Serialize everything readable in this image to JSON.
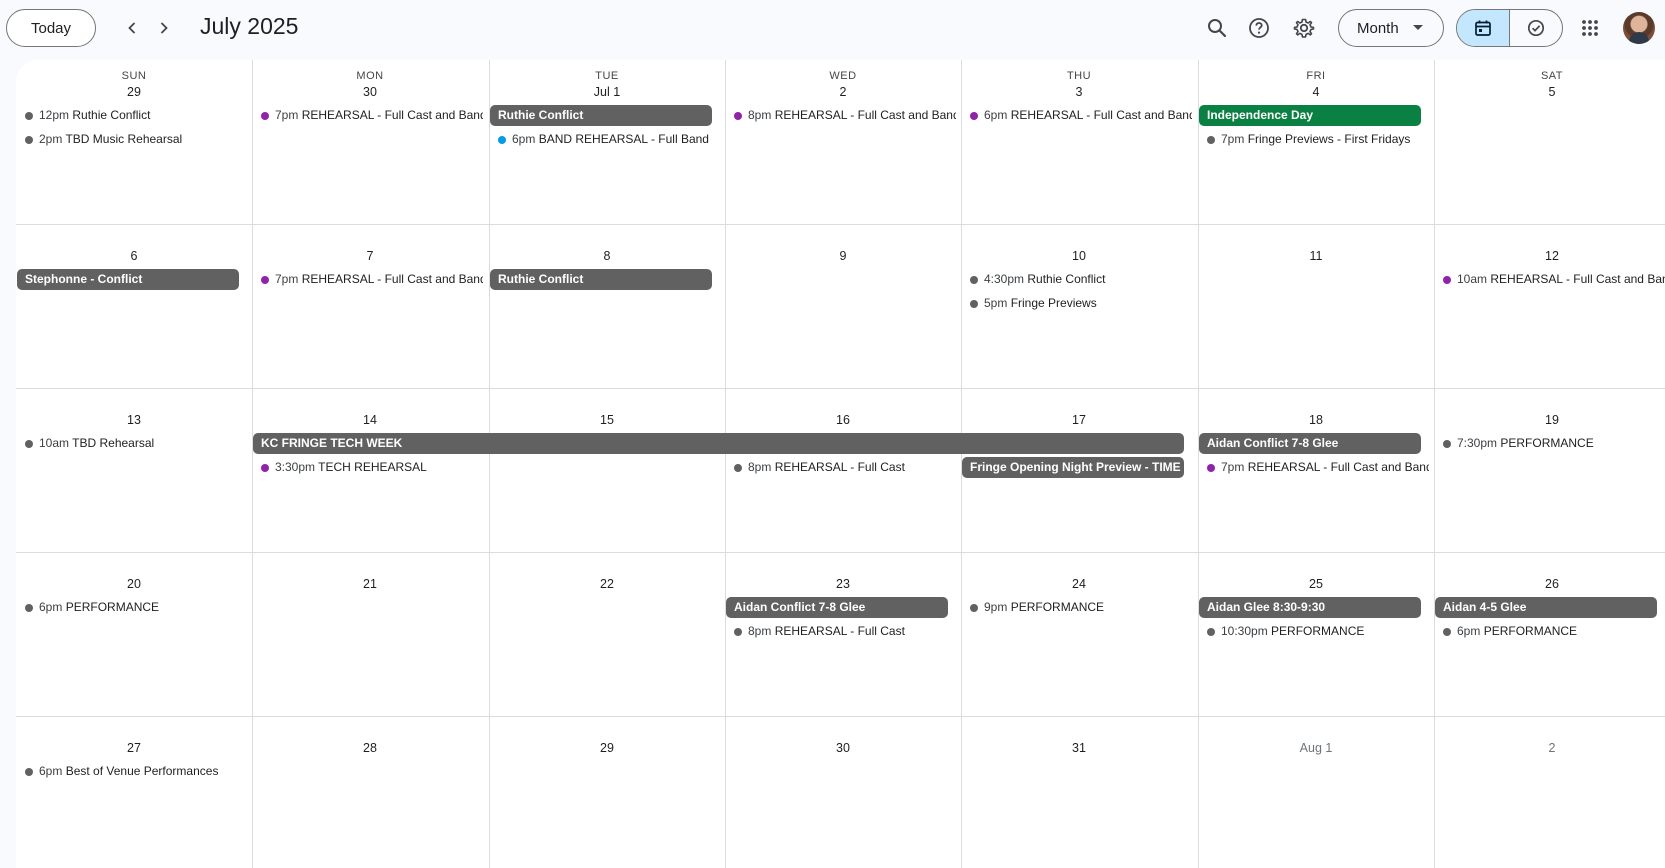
{
  "header": {
    "today_label": "Today",
    "month_title": "July 2025",
    "view_label": "Month"
  },
  "colors": {
    "accent": "#c2e7ff",
    "chip": "#616161",
    "holiday": "#0b8043",
    "dot_gray": "#616161",
    "dot_purple": "#8e24aa",
    "dot_teal": "#039be5"
  },
  "weekdays": [
    "SUN",
    "MON",
    "TUE",
    "WED",
    "THU",
    "FRI",
    "SAT"
  ],
  "weeks": [
    {
      "days": [
        "29",
        "30",
        "Jul 1",
        "2",
        "3",
        "4",
        "5"
      ],
      "chips": [
        {
          "col": 2,
          "span": 1,
          "row": 0,
          "label": "Ruthie Conflict",
          "color": "gray"
        },
        {
          "col": 5,
          "span": 1,
          "row": 0,
          "label": "Independence Day",
          "color": "green"
        }
      ],
      "events": [
        {
          "col": 0,
          "row": 0,
          "time": "12pm",
          "title": "Ruthie Conflict",
          "dot": "gray"
        },
        {
          "col": 0,
          "row": 1,
          "time": "2pm",
          "title": "TBD Music Rehearsal",
          "dot": "gray"
        },
        {
          "col": 1,
          "row": 0,
          "time": "7pm",
          "title": "REHEARSAL - Full Cast and Band",
          "dot": "purple"
        },
        {
          "col": 2,
          "row": 1,
          "time": "6pm",
          "title": "BAND REHEARSAL - Full Band",
          "dot": "teal"
        },
        {
          "col": 3,
          "row": 0,
          "time": "8pm",
          "title": "REHEARSAL - Full Cast and Band",
          "dot": "purple"
        },
        {
          "col": 4,
          "row": 0,
          "time": "6pm",
          "title": "REHEARSAL - Full Cast and Band",
          "dot": "purple"
        },
        {
          "col": 5,
          "row": 1,
          "time": "7pm",
          "title": "Fringe Previews - First Fridays",
          "dot": "gray"
        }
      ]
    },
    {
      "days": [
        "6",
        "7",
        "8",
        "9",
        "10",
        "11",
        "12"
      ],
      "chips": [
        {
          "col": 0,
          "span": 1,
          "row": 0,
          "label": "Stephonne - Conflict",
          "color": "gray"
        },
        {
          "col": 2,
          "span": 1,
          "row": 0,
          "label": "Ruthie Conflict",
          "color": "gray"
        }
      ],
      "events": [
        {
          "col": 1,
          "row": 0,
          "time": "7pm",
          "title": "REHEARSAL - Full Cast and Band",
          "dot": "purple"
        },
        {
          "col": 4,
          "row": 0,
          "time": "4:30pm",
          "title": "Ruthie Conflict",
          "dot": "gray"
        },
        {
          "col": 4,
          "row": 1,
          "time": "5pm",
          "title": "Fringe Previews",
          "dot": "gray"
        },
        {
          "col": 6,
          "row": 0,
          "time": "10am",
          "title": "REHEARSAL - Full Cast and Band",
          "dot": "purple"
        }
      ]
    },
    {
      "days": [
        "13",
        "14",
        "15",
        "16",
        "17",
        "18",
        "19"
      ],
      "chips": [
        {
          "col": 1,
          "span": 4,
          "row": 0,
          "label": "KC FRINGE TECH WEEK",
          "color": "gray"
        },
        {
          "col": 5,
          "span": 1,
          "row": 0,
          "label": "Aidan Conflict 7-8 Glee",
          "color": "gray"
        },
        {
          "col": 4,
          "span": 1,
          "row": 1,
          "label": "Fringe Opening Night Preview - TIME",
          "color": "gray"
        }
      ],
      "events": [
        {
          "col": 0,
          "row": 0,
          "time": "10am",
          "title": "TBD Rehearsal",
          "dot": "gray"
        },
        {
          "col": 1,
          "row": 1,
          "time": "3:30pm",
          "title": "TECH REHEARSAL",
          "dot": "purple"
        },
        {
          "col": 3,
          "row": 1,
          "time": "8pm",
          "title": "REHEARSAL - Full Cast",
          "dot": "gray"
        },
        {
          "col": 5,
          "row": 1,
          "time": "7pm",
          "title": "REHEARSAL - Full Cast and Band",
          "dot": "purple"
        },
        {
          "col": 6,
          "row": 0,
          "time": "7:30pm",
          "title": "PERFORMANCE",
          "dot": "gray"
        }
      ]
    },
    {
      "days": [
        "20",
        "21",
        "22",
        "23",
        "24",
        "25",
        "26"
      ],
      "chips": [
        {
          "col": 3,
          "span": 1,
          "row": 0,
          "label": "Aidan Conflict 7-8 Glee",
          "color": "gray"
        },
        {
          "col": 5,
          "span": 1,
          "row": 0,
          "label": "Aidan Glee 8:30-9:30",
          "color": "gray"
        },
        {
          "col": 6,
          "span": 1,
          "row": 0,
          "label": "Aidan 4-5 Glee",
          "color": "gray"
        }
      ],
      "events": [
        {
          "col": 0,
          "row": 0,
          "time": "6pm",
          "title": "PERFORMANCE",
          "dot": "gray"
        },
        {
          "col": 3,
          "row": 1,
          "time": "8pm",
          "title": "REHEARSAL - Full Cast",
          "dot": "gray"
        },
        {
          "col": 4,
          "row": 0,
          "time": "9pm",
          "title": "PERFORMANCE",
          "dot": "gray"
        },
        {
          "col": 5,
          "row": 1,
          "time": "10:30pm",
          "title": "PERFORMANCE",
          "dot": "gray"
        },
        {
          "col": 6,
          "row": 1,
          "time": "6pm",
          "title": "PERFORMANCE",
          "dot": "gray"
        }
      ]
    },
    {
      "days": [
        "27",
        "28",
        "29",
        "30",
        "31",
        "Aug 1",
        "2"
      ],
      "muted_from": 5,
      "chips": [],
      "events": [
        {
          "col": 0,
          "row": 0,
          "time": "6pm",
          "title": "Best of Venue Performances",
          "dot": "gray"
        }
      ]
    }
  ]
}
